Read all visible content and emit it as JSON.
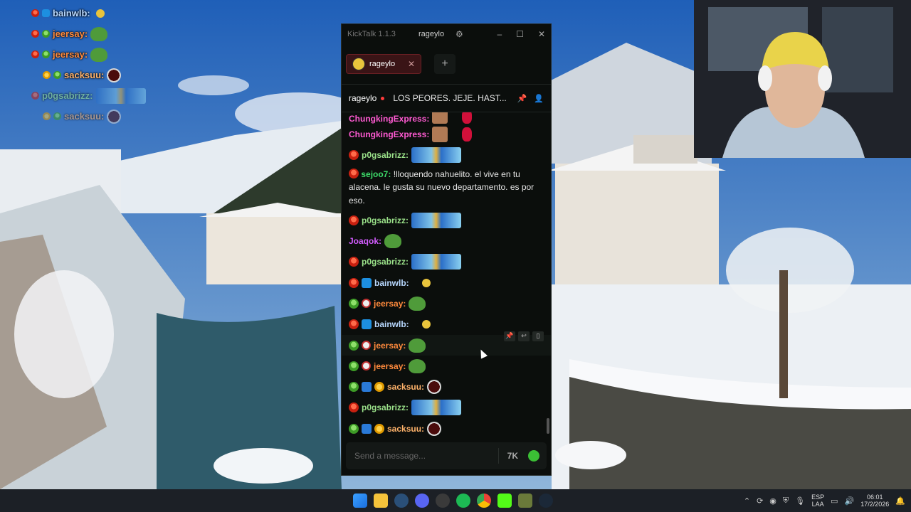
{
  "window": {
    "app_name": "KickTalk 1.1.3",
    "username": "rageylo",
    "minimize": "–",
    "maximize": "☐",
    "close": "✕"
  },
  "tabs": [
    {
      "label": "rageylo",
      "close": "✕"
    }
  ],
  "add_tab": "+",
  "channel": {
    "name": "rageylo",
    "title": "LOS PEORES. JEJE. HAST..."
  },
  "messages": [
    {
      "user": "ChungkingExpress:",
      "color": "#ff5ad2"
    },
    {
      "user": "ChungkingExpress:",
      "color": "#ff5ad2"
    },
    {
      "user": "p0gsabrizz:",
      "color": "#9be28a"
    },
    {
      "user": "sejoo7:",
      "color": "#3ddc6a",
      "text": "!lloquendo nahuelito. el vive en tu alacena. le gusta su nuevo departamento. es por eso."
    },
    {
      "user": "p0gsabrizz:",
      "color": "#9be28a"
    },
    {
      "user": "Joaqok:",
      "color": "#d35cff"
    },
    {
      "user": "p0gsabrizz:",
      "color": "#9be28a"
    },
    {
      "user": "bainwlb:",
      "color": "#b8d8ff"
    },
    {
      "user": "jeersay:",
      "color": "#ff8a3c"
    },
    {
      "user": "bainwlb:",
      "color": "#b8d8ff"
    },
    {
      "user": "jeersay:",
      "color": "#ff8a3c"
    },
    {
      "user": "jeersay:",
      "color": "#ff8a3c"
    },
    {
      "user": "sacksuu:",
      "color": "#ffb36b"
    },
    {
      "user": "p0gsabrizz:",
      "color": "#9be28a"
    },
    {
      "user": "sacksuu:",
      "color": "#ffb36b"
    }
  ],
  "input": {
    "placeholder": "Send a message..."
  },
  "overlay": [
    {
      "user": "bainwlb:"
    },
    {
      "user": "jeersay:"
    },
    {
      "user": "jeersay:"
    },
    {
      "user": "sacksuu:"
    },
    {
      "user": "p0gsabrizz:"
    },
    {
      "user": "sacksuu:"
    }
  ],
  "tray": {
    "lang_top": "ESP",
    "lang_bottom": "LAA",
    "time": "06:01",
    "date": "17/2/2026"
  },
  "colors": {
    "accent": "#3bbf35",
    "tab_bg": "#3a1416",
    "window_bg": "#0b0e0c"
  }
}
